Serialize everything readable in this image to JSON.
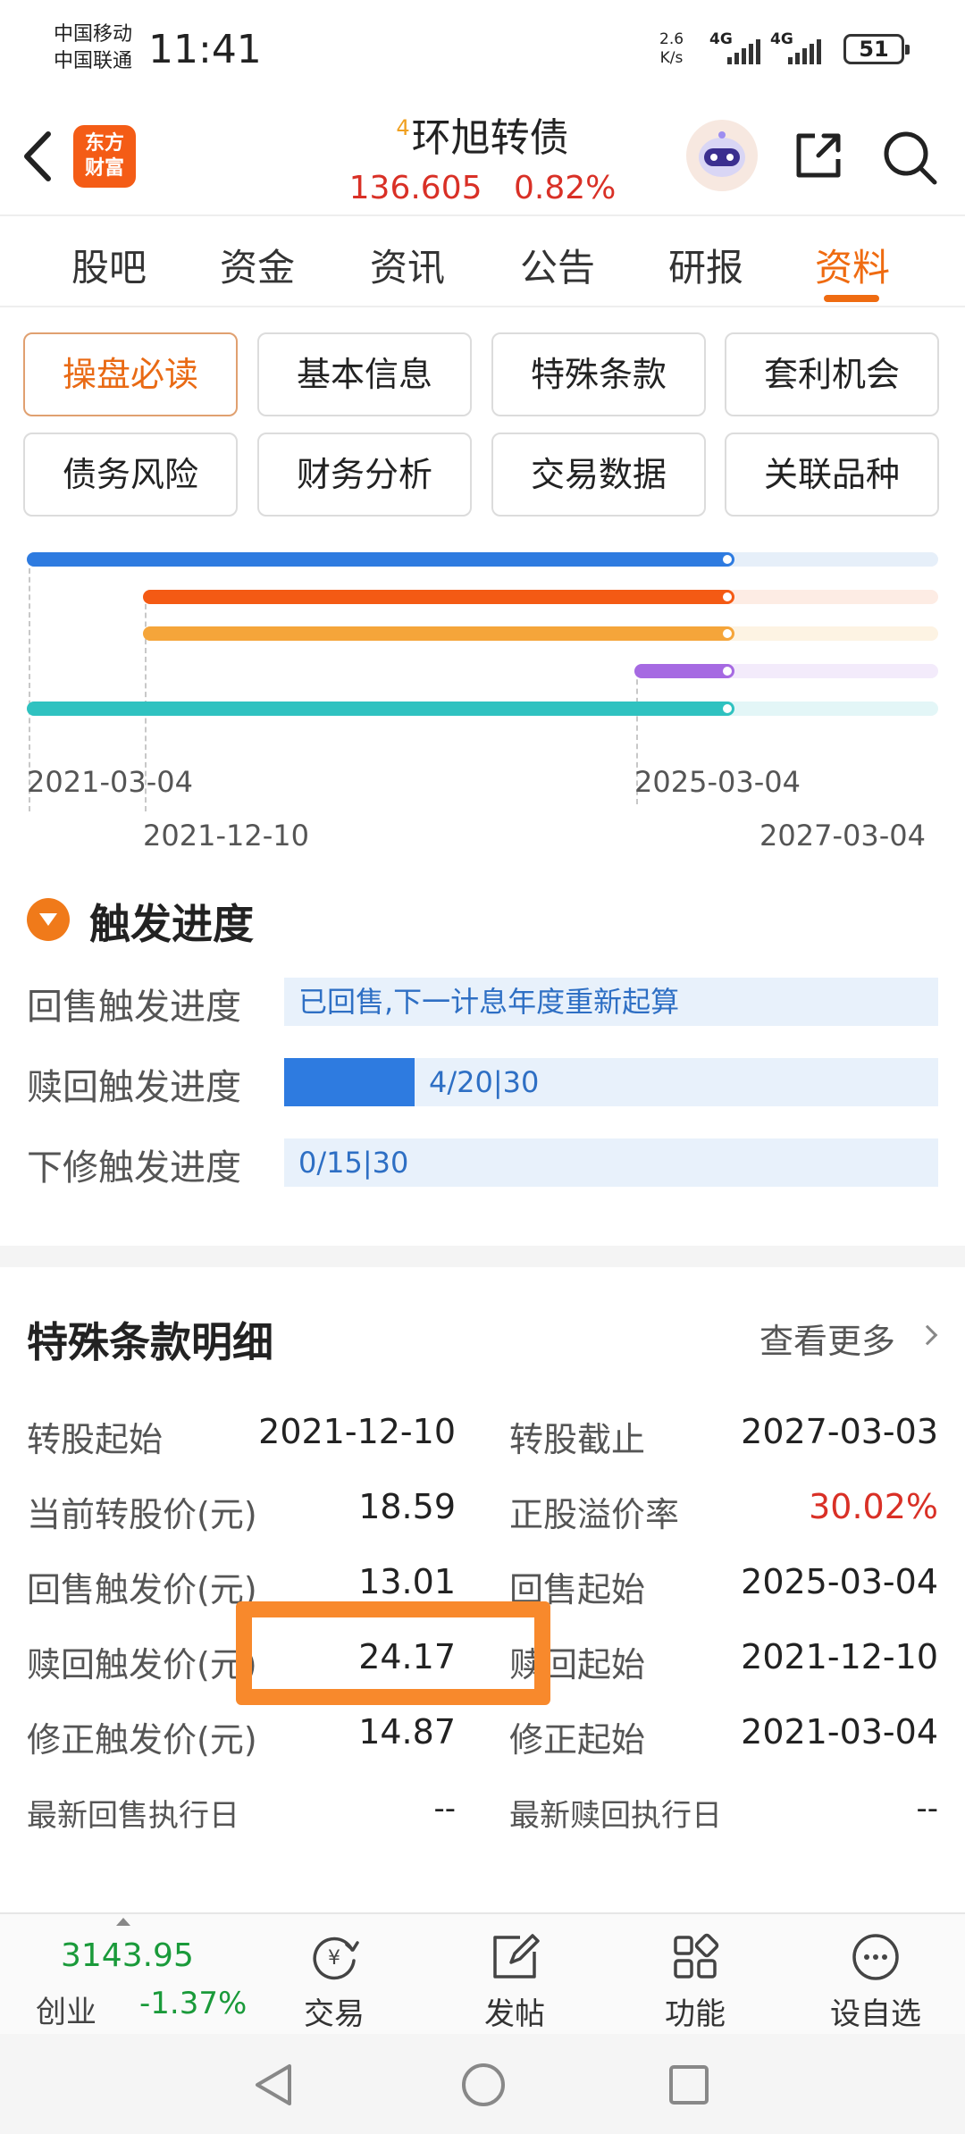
{
  "status_bar": {
    "carrier1": "中国移动",
    "carrier2": "中国联通",
    "time": "11:41",
    "net_speed_value": "2.6",
    "net_speed_unit": "K/s",
    "sim1": "4G",
    "sim2": "4G",
    "battery": "51"
  },
  "header": {
    "logo_line1": "东方",
    "logo_line2": "财富",
    "badge": "4",
    "title": "环旭转债",
    "price": "136.605",
    "change_pct": "0.82%",
    "price_color": "#d93026"
  },
  "tabs": [
    {
      "label": "股吧"
    },
    {
      "label": "资金"
    },
    {
      "label": "资讯"
    },
    {
      "label": "公告"
    },
    {
      "label": "研报"
    },
    {
      "label": "资料",
      "active": true
    }
  ],
  "sub_buttons": [
    {
      "label": "操盘必读",
      "active": true
    },
    {
      "label": "基本信息"
    },
    {
      "label": "特殊条款"
    },
    {
      "label": "套利机会"
    },
    {
      "label": "债务风险"
    },
    {
      "label": "财务分析"
    },
    {
      "label": "交易数据"
    },
    {
      "label": "关联品种"
    }
  ],
  "timeline": {
    "dates": {
      "start": "2021-03-04",
      "convert_start": "2021-12-10",
      "putback_start": "2025-03-04",
      "end": "2027-03-04"
    },
    "bars": [
      {
        "color": "#2e7be0",
        "track": "#e6eff9"
      },
      {
        "color": "#f45a14",
        "track": "#fdece4"
      },
      {
        "color": "#f5a53a",
        "track": "#fdf3e3"
      },
      {
        "color": "#a66ae2",
        "track": "#f3ebfb"
      },
      {
        "color": "#2fc2c0",
        "track": "#e3f6f7"
      }
    ]
  },
  "trigger": {
    "title": "触发进度",
    "rows": [
      {
        "label": "回售触发进度",
        "text": "已回售,下一计息年度重新起算",
        "progress": 0
      },
      {
        "label": "赎回触发进度",
        "text": "4/20|30",
        "progress": 0.2
      },
      {
        "label": "下修触发进度",
        "text": "0/15|30",
        "progress": 0
      }
    ]
  },
  "clauses": {
    "title": "特殊条款明细",
    "more": "查看更多",
    "rows": [
      {
        "k1": "转股起始",
        "v1": "2021-12-10",
        "k2": "转股截止",
        "v2": "2027-03-03"
      },
      {
        "k1": "当前转股价(元)",
        "v1": "18.59",
        "k2": "正股溢价率",
        "v2": "30.02%"
      },
      {
        "k1": "回售触发价(元)",
        "v1": "13.01",
        "k2": "回售起始",
        "v2": "2025-03-04"
      },
      {
        "k1": "赎回触发价(元)",
        "v1": "24.17",
        "k2": "赎回起始",
        "v2": "2021-12-10"
      },
      {
        "k1": "修正触发价(元)",
        "v1": "14.87",
        "k2": "修正起始",
        "v2": "2021-03-04"
      },
      {
        "k1": "最新回售执行日",
        "v1": "--",
        "k2": "最新赎回执行日",
        "v2": "--"
      }
    ]
  },
  "bottom_bar": {
    "index_value": "3143.95",
    "index_name": "创业",
    "index_change": "-1.37%",
    "items": [
      {
        "label": "交易",
        "icon": "yen-refresh-icon"
      },
      {
        "label": "发帖",
        "icon": "edit-post-icon"
      },
      {
        "label": "功能",
        "icon": "grid-apps-icon"
      },
      {
        "label": "设自选",
        "icon": "more-dots-icon"
      }
    ]
  }
}
